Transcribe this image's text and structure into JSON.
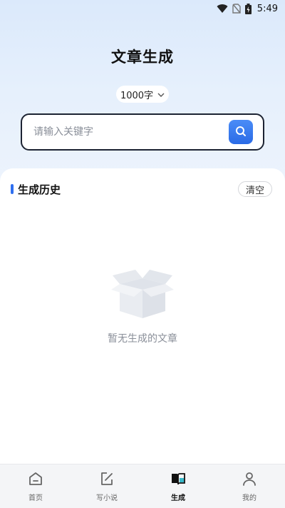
{
  "status_bar": {
    "time": "5:49",
    "icons": [
      "wifi-icon",
      "no-sim-icon",
      "battery-icon"
    ]
  },
  "page": {
    "title": "文章生成"
  },
  "word_count": {
    "selected": "1000字"
  },
  "search": {
    "placeholder": "请输入关键字",
    "value": ""
  },
  "history": {
    "title": "生成历史",
    "clear_label": "清空",
    "empty_text": "暂无生成的文章"
  },
  "tabs": [
    {
      "label": "首页",
      "icon": "home-icon",
      "active": false
    },
    {
      "label": "写小说",
      "icon": "edit-icon",
      "active": false
    },
    {
      "label": "生成",
      "icon": "book-icon",
      "active": true
    },
    {
      "label": "我的",
      "icon": "user-icon",
      "active": false
    }
  ],
  "colors": {
    "accent": "#2f6ff0",
    "background_top": "#dbe9fb",
    "tab_bar": "#f4f5f7"
  }
}
